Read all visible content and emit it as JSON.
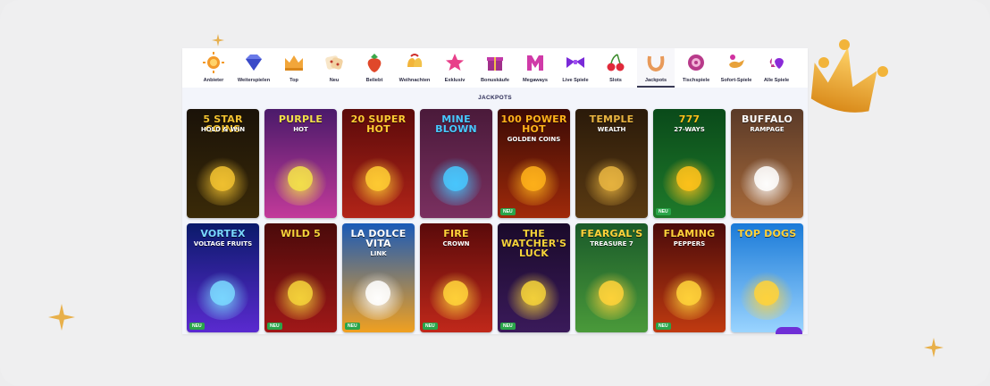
{
  "categories": [
    {
      "label": "Anbieter",
      "icon": "sun-icon"
    },
    {
      "label": "Weiterspielen",
      "icon": "diamond-icon"
    },
    {
      "label": "Top",
      "icon": "crown-icon"
    },
    {
      "label": "Neu",
      "icon": "dice-icon"
    },
    {
      "label": "Beliebt",
      "icon": "strawberry-icon"
    },
    {
      "label": "Weihnachten",
      "icon": "bells-icon"
    },
    {
      "label": "Exklusiv",
      "icon": "star-icon"
    },
    {
      "label": "Bonuskäufe",
      "icon": "gift-icon"
    },
    {
      "label": "Megaways",
      "icon": "m-letter-icon"
    },
    {
      "label": "Live Spiele",
      "icon": "bowtie-icon"
    },
    {
      "label": "Slots",
      "icon": "cherries-icon"
    },
    {
      "label": "Jackpots",
      "icon": "horseshoe-icon",
      "active": true
    },
    {
      "label": "Tischspiele",
      "icon": "roulette-chip-icon"
    },
    {
      "label": "Sofort-Spiele",
      "icon": "magic-lamp-icon"
    },
    {
      "label": "Alle Spiele",
      "icon": "card-suits-icon"
    }
  ],
  "section_title": "JACKPOTS",
  "games": [
    {
      "title": "5 STAR COINS",
      "subtitle": "HOLD & WIN",
      "badge": "",
      "bg1": "#1a1208",
      "bg2": "#3a2a08",
      "accent": "#f2c230"
    },
    {
      "title": "PURPLE",
      "subtitle": "HOT",
      "badge": "",
      "bg1": "#4a1a6a",
      "bg2": "#c23a9a",
      "accent": "#f3e04a"
    },
    {
      "title": "20 SUPER HOT",
      "subtitle": "",
      "badge": "",
      "bg1": "#5a0a0a",
      "bg2": "#b22418",
      "accent": "#ffcc33"
    },
    {
      "title": "MINE BLOWN",
      "subtitle": "",
      "badge": "",
      "bg1": "#4a1a3a",
      "bg2": "#7a3060",
      "accent": "#48c8ff"
    },
    {
      "title": "100 POWER HOT",
      "subtitle": "GOLDEN COINS",
      "badge": "NEU",
      "bg1": "#3a0a05",
      "bg2": "#a02a0a",
      "accent": "#ffb21a"
    },
    {
      "title": "TEMPLE",
      "subtitle": "WEALTH",
      "badge": "",
      "bg1": "#2a1a0a",
      "bg2": "#5a3a12",
      "accent": "#e8b440"
    },
    {
      "title": "777",
      "subtitle": "27-WAYS",
      "badge": "NEU",
      "bg1": "#0a4a1a",
      "bg2": "#1e7a2a",
      "accent": "#ffc21a"
    },
    {
      "title": "BUFFALO",
      "subtitle": "RAMPAGE",
      "badge": "",
      "bg1": "#5a3a28",
      "bg2": "#a86a3a",
      "accent": "#ffffff"
    },
    {
      "title": "VORTEX",
      "subtitle": "VOLTAGE FRUITS",
      "badge": "NEU",
      "bg1": "#0a1a6a",
      "bg2": "#5a2ad0",
      "accent": "#7ad8ff"
    },
    {
      "title": "Wild 5",
      "subtitle": "",
      "badge": "NEU",
      "bg1": "#4a0a0a",
      "bg2": "#a01818",
      "accent": "#f4d23a"
    },
    {
      "title": "La Dolce Vita",
      "subtitle": "LINK",
      "badge": "NEU",
      "bg1": "#1a5ab8",
      "bg2": "#f0a020",
      "accent": "#ffffff"
    },
    {
      "title": "FIRE",
      "subtitle": "CROWN",
      "badge": "NEU",
      "bg1": "#5a0a0a",
      "bg2": "#c0281a",
      "accent": "#ffd23a"
    },
    {
      "title": "THE WATCHER'S LUCK",
      "subtitle": "",
      "badge": "NEU",
      "bg1": "#1a0a2a",
      "bg2": "#3a1a5a",
      "accent": "#f4d23a"
    },
    {
      "title": "FEARGAL'S",
      "subtitle": "TREASURE 7",
      "badge": "",
      "bg1": "#1a5a2a",
      "bg2": "#4a9a3a",
      "accent": "#ffd23a"
    },
    {
      "title": "Flaming",
      "subtitle": "Peppers",
      "badge": "NEU",
      "bg1": "#4a0a0a",
      "bg2": "#c03a10",
      "accent": "#ffd23a"
    },
    {
      "title": "TOP DOGS",
      "subtitle": "",
      "badge": "",
      "bg1": "#1a7ad8",
      "bg2": "#9ad4ff",
      "accent": "#ffd23a"
    }
  ],
  "colors": {
    "active_underline": "#3a3a55",
    "title": "#2a2a55",
    "badge": "#2aa54a",
    "chat": "#6f2fd6"
  }
}
